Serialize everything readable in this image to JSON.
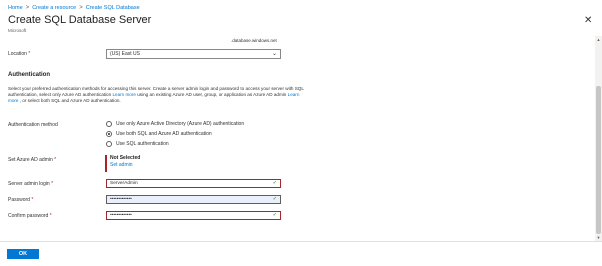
{
  "breadcrumb": {
    "items": [
      "Home",
      "Create a resource",
      "Create SQL Database"
    ],
    "separator": ">"
  },
  "header": {
    "title": "Create SQL Database Server",
    "more": "···",
    "publisher": "Microsoft",
    "close": "✕"
  },
  "server_name": {
    "suffix": ".database.windows.net"
  },
  "location": {
    "label": "Location",
    "required": "*",
    "value": "(US) East US"
  },
  "authentication": {
    "heading": "Authentication",
    "description_1": "Select your preferred authentication methods for accessing this server. Create a server admin login and password to access your server with SQL authentication, select only Azure AD authentication ",
    "learn_more_1": "Learn more",
    "description_2": " using an existing Azure AD user, group, or application as Azure AD admin ",
    "learn_more_2": "Learn more",
    "description_3": " , or select both SQL and Azure AD authentication.",
    "method_label": "Authentication method",
    "options": [
      {
        "label": "Use only Azure Active Directory (Azure AD) authentication",
        "checked": false
      },
      {
        "label": "Use both SQL and Azure AD authentication",
        "checked": true
      },
      {
        "label": "Use SQL authentication",
        "checked": false
      }
    ]
  },
  "azure_ad_admin": {
    "label": "Set Azure AD admin",
    "required": "*",
    "status": "Not Selected",
    "link": "Set admin"
  },
  "admin_login": {
    "label": "Server admin login",
    "required": "*",
    "value": "ServerAdmin"
  },
  "password": {
    "label": "Password",
    "required": "*",
    "value": "•••••••••••••"
  },
  "confirm_password": {
    "label": "Confirm password",
    "required": "*",
    "value": "•••••••••••••"
  },
  "footer": {
    "ok_label": "OK"
  },
  "colors": {
    "accent": "#0078d4",
    "error": "#a4262c",
    "valid": "#107c10"
  }
}
